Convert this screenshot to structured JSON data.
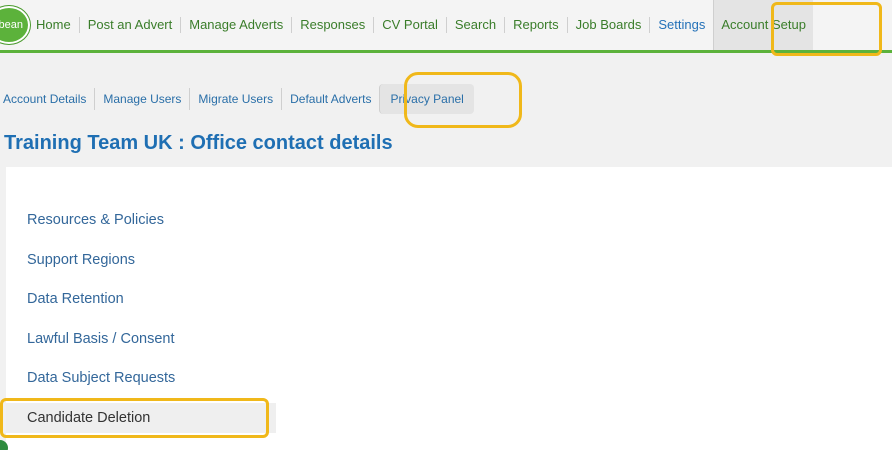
{
  "app": {
    "logo_text": "bean",
    "brand_color": "#5cb23b",
    "highlight_color": "#f0b81a"
  },
  "topnav": {
    "items": [
      {
        "label": "Home"
      },
      {
        "label": "Post an Advert"
      },
      {
        "label": "Manage Adverts"
      },
      {
        "label": "Responses"
      },
      {
        "label": "CV Portal"
      },
      {
        "label": "Search"
      },
      {
        "label": "Reports"
      },
      {
        "label": "Job Boards"
      },
      {
        "label": "Settings"
      },
      {
        "label": "Account Setup"
      }
    ],
    "active": "Account Setup"
  },
  "subnav": {
    "items": [
      {
        "label": "Account Details"
      },
      {
        "label": "Manage Users"
      },
      {
        "label": "Migrate Users"
      },
      {
        "label": "Default Adverts"
      },
      {
        "label": "Privacy Panel"
      }
    ],
    "active": "Privacy Panel"
  },
  "page": {
    "title": "Training Team UK : Office contact details"
  },
  "privacy_menu": {
    "items": [
      {
        "label": "Resources & Policies"
      },
      {
        "label": "Support Regions"
      },
      {
        "label": "Data Retention"
      },
      {
        "label": "Lawful Basis / Consent"
      },
      {
        "label": "Data Subject Requests"
      },
      {
        "label": "Candidate Deletion"
      }
    ],
    "selected": "Candidate Deletion"
  }
}
